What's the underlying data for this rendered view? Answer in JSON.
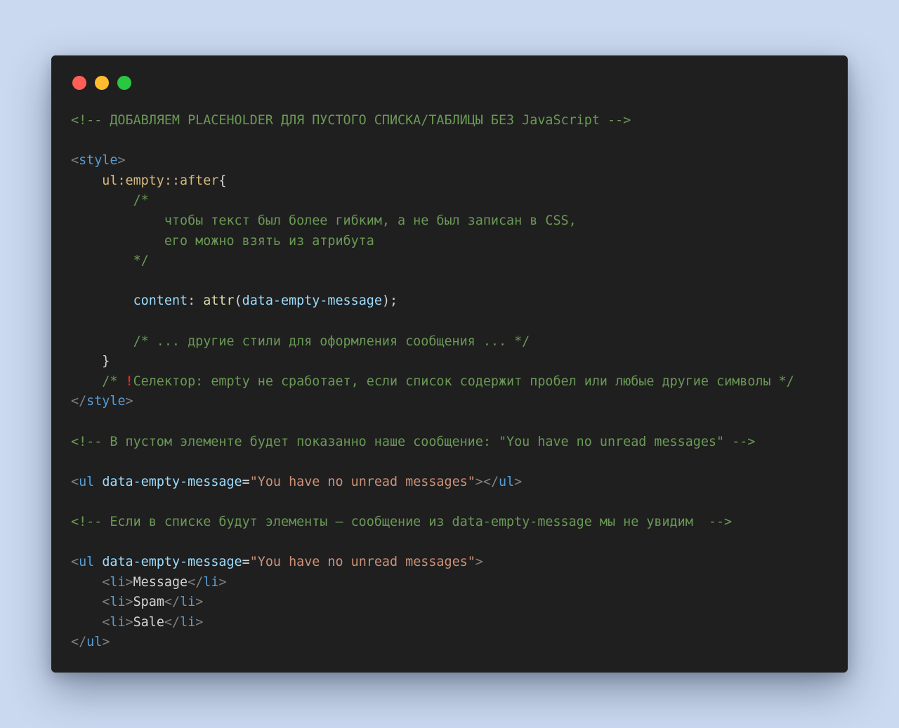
{
  "window": {
    "buttons": [
      {
        "name": "close",
        "color": "#ff5f57"
      },
      {
        "name": "minimize",
        "color": "#febc2e"
      },
      {
        "name": "zoom",
        "color": "#28c840"
      }
    ]
  },
  "colors": {
    "background": "#cad9f0",
    "editor": "#1f1f1f",
    "comment": "#6a9955",
    "punct": "#808080",
    "tag": "#569cd6",
    "selector": "#d7ba7d",
    "property": "#9cdcfe",
    "function": "#dcdcaa",
    "string": "#ce9178",
    "text": "#d4d4d4",
    "warning": "#e5281f"
  },
  "code_lines": [
    [
      {
        "t": "<!-- ДОБАВЛЯЕМ PLACEHOLDER ДЛЯ ПУСТОГО СПИСКА/ТАБЛИЦЫ БЕЗ JavaScript -->",
        "c": "comment"
      }
    ],
    [],
    [
      {
        "t": "<",
        "c": "punct"
      },
      {
        "t": "style",
        "c": "tag"
      },
      {
        "t": ">",
        "c": "punct"
      }
    ],
    [
      {
        "t": "    ",
        "c": "text"
      },
      {
        "t": "ul:empty::after",
        "c": "selector"
      },
      {
        "t": "{",
        "c": "text"
      }
    ],
    [
      {
        "t": "        /*",
        "c": "comment"
      }
    ],
    [
      {
        "t": "            чтобы текст был более гибким, а не был записан в CSS,",
        "c": "comment"
      }
    ],
    [
      {
        "t": "            его можно взять из атрибута",
        "c": "comment"
      }
    ],
    [
      {
        "t": "        */",
        "c": "comment"
      }
    ],
    [],
    [
      {
        "t": "        ",
        "c": "text"
      },
      {
        "t": "content",
        "c": "prop"
      },
      {
        "t": ": ",
        "c": "text"
      },
      {
        "t": "attr",
        "c": "fn"
      },
      {
        "t": "(",
        "c": "text"
      },
      {
        "t": "data-empty-message",
        "c": "prop"
      },
      {
        "t": ");",
        "c": "text"
      }
    ],
    [],
    [
      {
        "t": "        /* ... другие стили для оформления сообщения ... */",
        "c": "comment"
      }
    ],
    [
      {
        "t": "    }",
        "c": "text"
      }
    ],
    [
      {
        "t": "    /* ",
        "c": "comment"
      },
      {
        "t": "!",
        "c": "warn"
      },
      {
        "t": "Селектор: empty не сработает, если список содержит пробел или любые другие символы */",
        "c": "comment"
      }
    ],
    [
      {
        "t": "</",
        "c": "punct"
      },
      {
        "t": "style",
        "c": "tag"
      },
      {
        "t": ">",
        "c": "punct"
      }
    ],
    [],
    [
      {
        "t": "<!-- В пустом элементе будет показанно наше сообщение: \"You have no unread messages\" -->",
        "c": "comment"
      }
    ],
    [],
    [
      {
        "t": "<",
        "c": "punct"
      },
      {
        "t": "ul",
        "c": "tag"
      },
      {
        "t": " ",
        "c": "text"
      },
      {
        "t": "data-empty-message",
        "c": "attr"
      },
      {
        "t": "=",
        "c": "text"
      },
      {
        "t": "\"You have no unread messages\"",
        "c": "string"
      },
      {
        "t": "></",
        "c": "punct"
      },
      {
        "t": "ul",
        "c": "tag"
      },
      {
        "t": ">",
        "c": "punct"
      }
    ],
    [],
    [
      {
        "t": "<!-- Если в списке будут элементы — сообщение из data-empty-message мы не увидим  -->",
        "c": "comment"
      }
    ],
    [],
    [
      {
        "t": "<",
        "c": "punct"
      },
      {
        "t": "ul",
        "c": "tag"
      },
      {
        "t": " ",
        "c": "text"
      },
      {
        "t": "data-empty-message",
        "c": "attr"
      },
      {
        "t": "=",
        "c": "text"
      },
      {
        "t": "\"You have no unread messages\"",
        "c": "string"
      },
      {
        "t": ">",
        "c": "punct"
      }
    ],
    [
      {
        "t": "    <",
        "c": "punct"
      },
      {
        "t": "li",
        "c": "tag"
      },
      {
        "t": ">",
        "c": "punct"
      },
      {
        "t": "Message",
        "c": "text"
      },
      {
        "t": "</",
        "c": "punct"
      },
      {
        "t": "li",
        "c": "tag"
      },
      {
        "t": ">",
        "c": "punct"
      }
    ],
    [
      {
        "t": "    <",
        "c": "punct"
      },
      {
        "t": "li",
        "c": "tag"
      },
      {
        "t": ">",
        "c": "punct"
      },
      {
        "t": "Spam",
        "c": "text"
      },
      {
        "t": "</",
        "c": "punct"
      },
      {
        "t": "li",
        "c": "tag"
      },
      {
        "t": ">",
        "c": "punct"
      }
    ],
    [
      {
        "t": "    <",
        "c": "punct"
      },
      {
        "t": "li",
        "c": "tag"
      },
      {
        "t": ">",
        "c": "punct"
      },
      {
        "t": "Sale",
        "c": "text"
      },
      {
        "t": "</",
        "c": "punct"
      },
      {
        "t": "li",
        "c": "tag"
      },
      {
        "t": ">",
        "c": "punct"
      }
    ],
    [
      {
        "t": "</",
        "c": "punct"
      },
      {
        "t": "ul",
        "c": "tag"
      },
      {
        "t": ">",
        "c": "punct"
      }
    ]
  ]
}
